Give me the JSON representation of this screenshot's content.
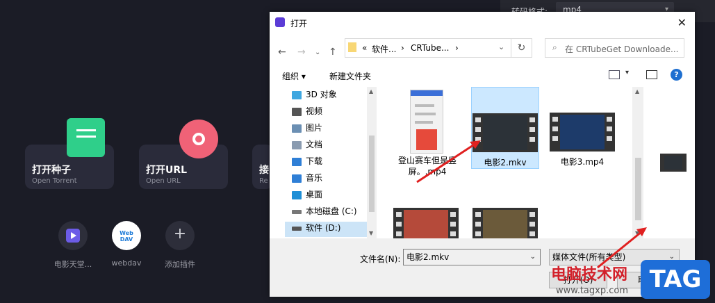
{
  "app": {
    "format_label": "转码格式:",
    "format_value": "mp4",
    "cards": [
      {
        "title": "打开种子",
        "subtitle": "Open Torrent"
      },
      {
        "title": "打开URL",
        "subtitle": "Open URL"
      },
      {
        "title": "接",
        "subtitle": "Re"
      }
    ],
    "plugins": [
      {
        "label": "电影天堂..."
      },
      {
        "label": "webdav",
        "icon_text": "Web DAV"
      },
      {
        "label": "添加插件"
      }
    ]
  },
  "dialog": {
    "title": "打开",
    "breadcrumb": [
      "«",
      "软件...",
      "›",
      "CRTube...",
      "›"
    ],
    "search_placeholder": "在 CRTubeGet Downloade...",
    "toolbar": {
      "organize": "组织 ▾",
      "new_folder": "新建文件夹"
    },
    "sidebar": [
      {
        "label": "3D 对象",
        "icon": "3d-objects-icon",
        "color": "#3fa7e0"
      },
      {
        "label": "视频",
        "icon": "video-icon",
        "color": "#555555"
      },
      {
        "label": "图片",
        "icon": "picture-icon",
        "color": "#6b8fb3"
      },
      {
        "label": "文档",
        "icon": "document-icon",
        "color": "#8a9bb0"
      },
      {
        "label": "下载",
        "icon": "download-icon",
        "color": "#2f7fd6"
      },
      {
        "label": "音乐",
        "icon": "music-icon",
        "color": "#2f7fd6"
      },
      {
        "label": "桌面",
        "icon": "desktop-icon",
        "color": "#1f8fd6"
      },
      {
        "label": "本地磁盘 (C:)",
        "icon": "drive-icon",
        "color": "#777777"
      },
      {
        "label": "软件 (D:)",
        "icon": "drive-icon",
        "color": "#555555"
      }
    ],
    "files": [
      {
        "name": "登山赛车但是竖屏。.mp4"
      },
      {
        "name": "电影2.mkv"
      },
      {
        "name": "电影3.mp4"
      }
    ],
    "filename_label": "文件名(N):",
    "filename_value": "电影2.mkv",
    "filetype_value": "媒体文件(所有类型)",
    "open_button": "打开(O)",
    "cancel_button": "取消"
  },
  "watermark": {
    "site_name": "电脑技术网",
    "url": "www.tagxp.com",
    "tag": "TAG"
  }
}
